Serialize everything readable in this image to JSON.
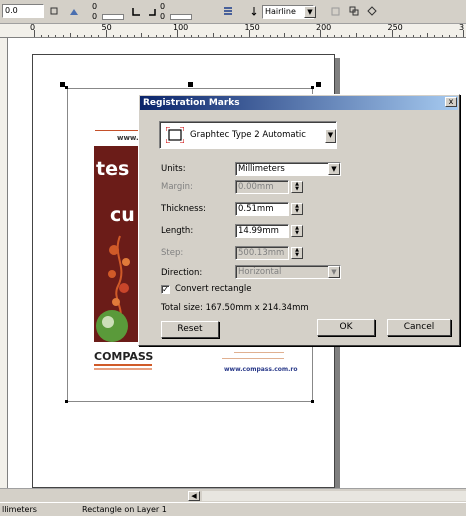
{
  "toolbar": {
    "x_value": "0.0",
    "spin_top_1": "0",
    "spin_bottom_1": "0",
    "spin_top_2": "0",
    "spin_bottom_2": "0",
    "outline_width": "Hairline"
  },
  "ruler": {
    "labels": [
      "0",
      "50",
      "100",
      "150",
      "200",
      "250",
      "3"
    ]
  },
  "poster": {
    "url_top": "www.",
    "headline_1": "tes",
    "headline_2": "cu",
    "brand": "COMPASS",
    "url_bottom": "www.compass.com.ro"
  },
  "dialog": {
    "title": "Registration Marks",
    "close_glyph": "x",
    "type_value": "Graphtec Type 2 Automatic",
    "units_label": "Units:",
    "units_value": "Millimeters",
    "margin_label": "Margin:",
    "margin_value": "0.00mm",
    "thickness_label": "Thickness:",
    "thickness_value": "0.51mm",
    "length_label": "Length:",
    "length_value": "14.99mm",
    "step_label": "Step:",
    "step_value": "500.13mm",
    "direction_label": "Direction:",
    "direction_value": "Horizontal",
    "convert_label": "Convert rectangle",
    "convert_checked": true,
    "total_size": "Total size:  167.50mm x 214.34mm",
    "reset_label": "Reset",
    "ok_label": "OK",
    "cancel_label": "Cancel"
  },
  "status": {
    "left": "llimeters",
    "object": "Rectangle on Layer 1"
  }
}
